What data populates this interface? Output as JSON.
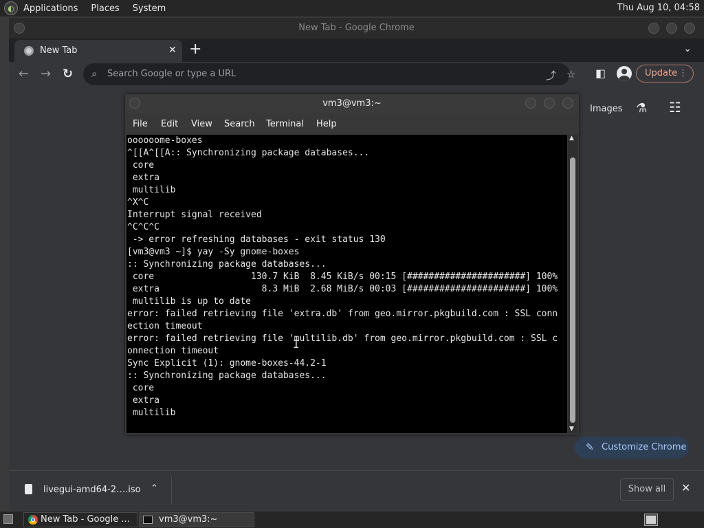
{
  "top_panel": {
    "menus": [
      "Applications",
      "Places",
      "System"
    ],
    "clock": "Thu Aug 10, 04:58"
  },
  "chrome": {
    "window_title": "New Tab - Google Chrome",
    "tab": {
      "title": "New Tab",
      "close": "✕"
    },
    "new_tab": "+",
    "tab_search": "⌄",
    "omnibox_placeholder": "Search Google or type a URL",
    "update_label": "Update",
    "ntp": {
      "images_label": "Images",
      "customize_label": "Customize Chrome"
    },
    "download": {
      "filename": "livegui-amd64-2….iso",
      "show_all": "Show all"
    }
  },
  "terminal": {
    "title": "vm3@vm3:~",
    "menus": [
      "File",
      "Edit",
      "View",
      "Search",
      "Terminal",
      "Help"
    ],
    "lines": [
      "oooooome-boxes",
      "^[[A^[[A:: Synchronizing package databases...",
      " core",
      " extra",
      " multilib",
      "^X^C",
      "Interrupt signal received",
      "^C^C^C",
      " -> error refreshing databases - exit status 130",
      "[vm3@vm3 ~]$ yay -Sy gnome-boxes",
      ":: Synchronizing package databases...",
      " core                  130.7 KiB  8.45 KiB/s 00:15 [######################] 100%",
      " extra                   8.3 MiB  2.68 MiB/s 00:03 [######################] 100%",
      " multilib is up to date",
      "error: failed retrieving file 'extra.db' from geo.mirror.pkgbuild.com : SSL conn",
      "ection timeout",
      "error: failed retrieving file 'multilib.db' from geo.mirror.pkgbuild.com : SSL c",
      "onnection timeout",
      "Sync Explicit (1): gnome-boxes-44.2-1",
      ":: Synchronizing package databases...",
      " core",
      " extra",
      " multilib"
    ]
  },
  "taskbar": {
    "tasks": [
      {
        "label": "New Tab - Google ..."
      },
      {
        "label": "vm3@vm3:~"
      }
    ]
  },
  "icons": {
    "back": "arrow-left-icon",
    "forward": "arrow-right-icon",
    "reload": "reload-icon",
    "search": "search-icon",
    "share": "share-icon",
    "bookmark": "star-icon",
    "side_panel": "side-panel-icon",
    "profile": "avatar-icon",
    "menu": "kebab-menu-icon",
    "labs": "flask-icon",
    "apps": "apps-grid-icon",
    "customize": "pencil-icon"
  },
  "colors": {
    "accent_update": "#f2a48b",
    "customize_bg": "#2c3f54",
    "customize_fg": "#a8c7fa",
    "terminal_bg": "#000000"
  }
}
